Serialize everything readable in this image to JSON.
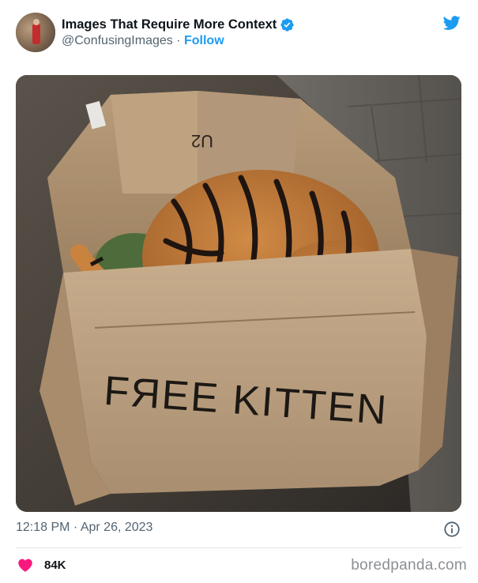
{
  "tweet": {
    "author_name": "Images That Require More Context",
    "handle": "@ConfusingImages",
    "separator": " · ",
    "follow_label": "Follow",
    "photo_text": "FЯEE KITTEN",
    "box_marking": "U2",
    "timestamp": "12:18 PM · Apr 26, 2023",
    "likes": "84K"
  },
  "footer": {
    "source": "boredpanda.com"
  },
  "icons": {
    "verified": "verified-badge-icon",
    "platform": "twitter-bird-icon",
    "info": "info-icon",
    "like": "heart-icon"
  },
  "colors": {
    "accent": "#1d9bf0",
    "like": "#f91880",
    "secondary_text": "#536471"
  }
}
